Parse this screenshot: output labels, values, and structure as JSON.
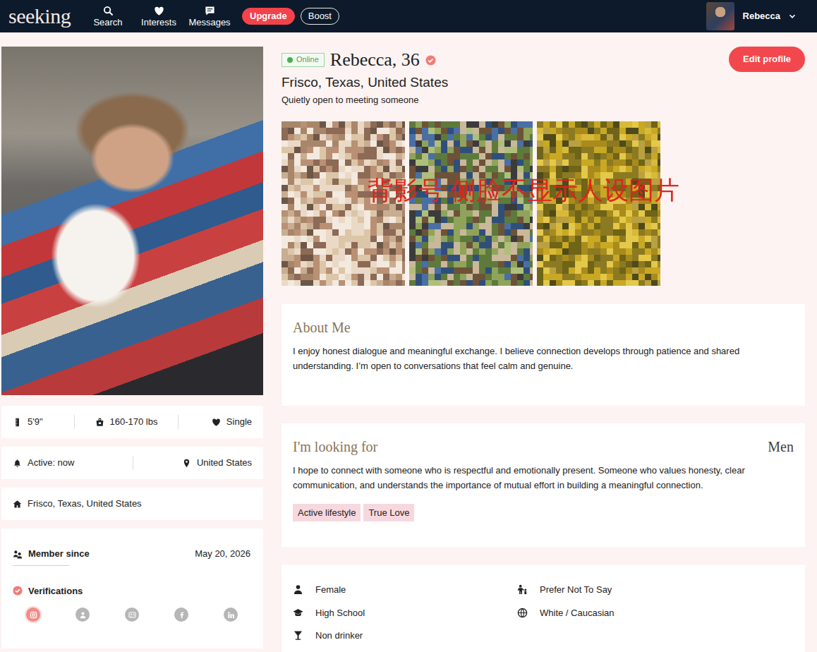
{
  "nav": {
    "logo": "seeking",
    "items": [
      {
        "kind": "search",
        "label": "Search"
      },
      {
        "kind": "interests",
        "label": "Interests"
      },
      {
        "kind": "messages",
        "label": "Messages"
      }
    ],
    "upgrade": "Upgrade",
    "boost": "Boost",
    "user": "Rebecca"
  },
  "profile": {
    "status": "Online",
    "online": true,
    "name": "Rebecca, 36",
    "verified": true,
    "location": "Frisco, Texas, United States",
    "tagline": "Quietly open to meeting someone",
    "edit_button": "Edit profile"
  },
  "gallery": {
    "photos": [
      {
        "blurred": true
      },
      {
        "blurred": true
      },
      {
        "blurred": true
      }
    ],
    "overlay": "背影号 侧脸不显示人设图片"
  },
  "stats": [
    {
      "kind": "height",
      "label": "5'9\""
    },
    {
      "kind": "weight",
      "label": "160-170 lbs"
    },
    {
      "kind": "relationship",
      "label": "Single"
    }
  ],
  "activity": [
    {
      "kind": "active",
      "label": "Active: now"
    },
    {
      "kind": "country",
      "label": "United States"
    }
  ],
  "home": "Frisco, Texas, United States",
  "member": {
    "label": "Member since",
    "date": "May 20, 2026"
  },
  "verifications": {
    "title": "Verifications",
    "items": [
      {
        "kind": "photo",
        "verified": true
      },
      {
        "kind": "profile",
        "verified": false
      },
      {
        "kind": "id",
        "verified": false
      },
      {
        "kind": "facebook",
        "verified": false
      },
      {
        "kind": "linkedin",
        "verified": false
      }
    ]
  },
  "about": {
    "title": "About Me",
    "text": "I enjoy honest dialogue and meaningful exchange. I believe connection develops through patience and shared understanding. I’m open to conversations that feel calm and genuine."
  },
  "looking_for": {
    "title": "I'm looking for",
    "target": "Men",
    "text": "I hope to connect with someone who is respectful and emotionally present. Someone who values honesty, clear communication, and understands the importance of mutual effort in building a meaningful connection.",
    "tags": [
      {
        "label": "Active lifestyle"
      },
      {
        "label": "True Love"
      }
    ]
  },
  "details": [
    {
      "kind": "gender",
      "label": "Female"
    },
    {
      "kind": "children",
      "label": "Prefer Not To Say"
    },
    {
      "kind": "education",
      "label": "High School"
    },
    {
      "kind": "ethnicity",
      "label": "White / Caucasian"
    },
    {
      "kind": "drinking",
      "label": "Non drinker"
    }
  ]
}
